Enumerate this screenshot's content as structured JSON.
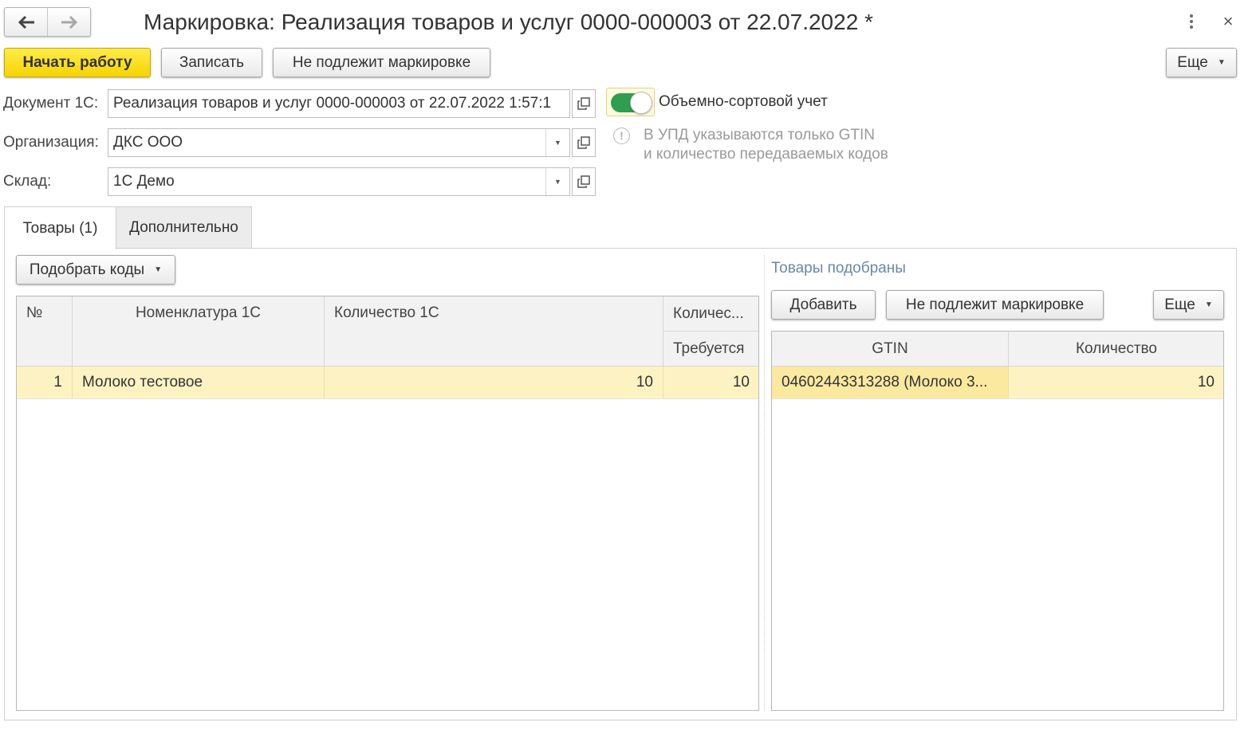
{
  "window": {
    "title": "Маркировка: Реализация товаров и услуг 0000-000003 от 22.07.2022 *",
    "close_glyph": "×"
  },
  "toolbar": {
    "start_label": "Начать работу",
    "save_label": "Записать",
    "not_marked_label": "Не подлежит маркировке",
    "more_label": "Еще"
  },
  "form": {
    "document_label": "Документ 1С:",
    "document_value": "Реализация товаров и услуг 0000-000003 от 22.07.2022 1:57:1",
    "organization_label": "Организация:",
    "organization_value": "ДКС ООО",
    "warehouse_label": "Склад:",
    "warehouse_value": "1С Демо",
    "volume_sort_label": "Объемно-сортовой учет",
    "volume_sort_on": true,
    "info_line1": "В УПД указываются только GTIN",
    "info_line2": "и количество передаваемых кодов",
    "info_glyph": "!"
  },
  "tabs": [
    {
      "label": "Товары (1)",
      "active": true
    },
    {
      "label": "Дополнительно",
      "active": false
    }
  ],
  "left_panel": {
    "pick_codes_label": "Подобрать коды",
    "columns": {
      "num": "№",
      "nomenclature": "Номенклатура 1С",
      "qty": "Количество 1С",
      "qty_short": "Количес...",
      "required": "Требуется"
    },
    "rows": [
      {
        "num": "1",
        "nomenclature": "Молоко тестовое",
        "qty": "10",
        "required": "10"
      }
    ]
  },
  "right_panel": {
    "title": "Товары подобраны",
    "add_label": "Добавить",
    "not_marked_label": "Не подлежит маркировке",
    "more_label": "Еще",
    "columns": {
      "gtin": "GTIN",
      "qty": "Количество"
    },
    "rows": [
      {
        "gtin": "04602443313288 (Молоко 3...",
        "qty": "10"
      }
    ]
  },
  "colors": {
    "primary_button": "#f5d400",
    "selected_row": "#fdf3c2",
    "toggle_on": "#2f9e4f",
    "section_title": "#6a88a8"
  }
}
